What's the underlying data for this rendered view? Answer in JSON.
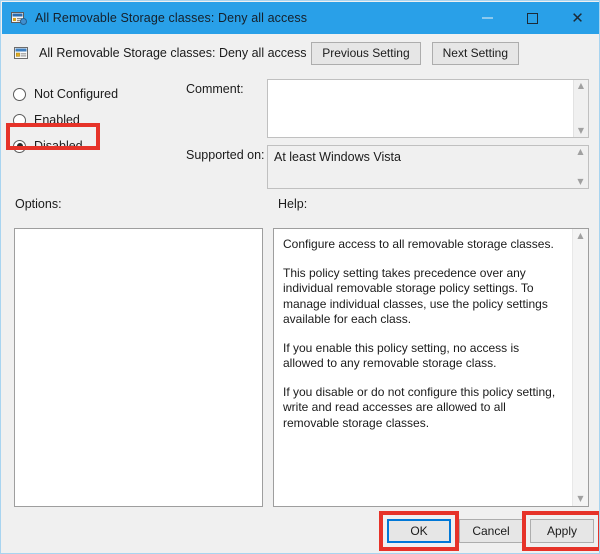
{
  "window": {
    "title": "All Removable Storage classes: Deny all access",
    "title_icon": "policy-setting-icon",
    "controls": {
      "minimize": "minimize-icon",
      "maximize": "maximize-icon",
      "close": "close-icon"
    }
  },
  "header": {
    "icon": "policy-setting-icon",
    "title": "All Removable Storage classes: Deny all access",
    "previous_setting": "Previous Setting",
    "next_setting": "Next Setting"
  },
  "state_options": [
    {
      "label": "Not Configured",
      "selected": false
    },
    {
      "label": "Enabled",
      "selected": false
    },
    {
      "label": "Disabled",
      "selected": true
    }
  ],
  "fields": {
    "comment_label": "Comment:",
    "comment_value": "",
    "supported_label": "Supported on:",
    "supported_value": "At least Windows Vista"
  },
  "sections": {
    "options_label": "Options:",
    "help_label": "Help:"
  },
  "help_paragraphs": [
    "Configure access to all removable storage classes.",
    "This policy setting takes precedence over any individual removable storage policy settings. To manage individual classes, use the policy settings available for each class.",
    "If you enable this policy setting, no access is allowed to any removable storage class.",
    "If you disable or do not configure this policy setting, write and read accesses are allowed to all removable storage classes."
  ],
  "footer": {
    "ok": "OK",
    "cancel": "Cancel",
    "apply": "Apply"
  },
  "annotations": {
    "highlight_color": "#e63329",
    "focus_color": "#0078d7",
    "titlebar_color": "#29a0e8",
    "highlighted": [
      "Disabled",
      "OK",
      "Apply"
    ]
  }
}
